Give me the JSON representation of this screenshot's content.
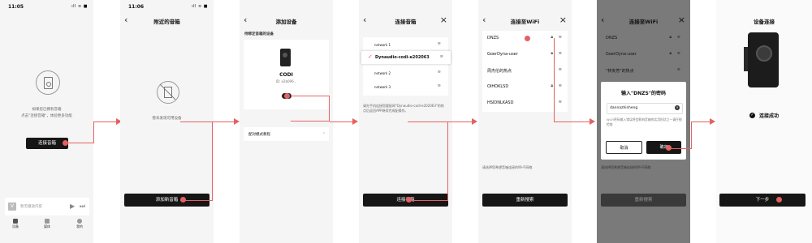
{
  "screen1": {
    "time": "11:05",
    "status_icons": "ıll ≋ ■",
    "empty_text_1": "如果您已拥有音箱",
    "empty_text_2": "点击\"连接音箱\"，体验更多功能",
    "connect_button": "连接音箱",
    "player_placeholder": "暂无播放内容",
    "nav": [
      "设备",
      "媒体",
      "我的"
    ]
  },
  "screen2": {
    "time": "11:06",
    "status_icons": "ıll ≋ ■",
    "title": "附近的音箱",
    "empty_text": "暂未发现可用设备",
    "add_button": "添加新音箱"
  },
  "screen3": {
    "title": "添加设备",
    "section": "待绑定音箱的设备",
    "device_name": "CODI",
    "device_id": "ID: e2b096...",
    "pair_mode": "配对模式教程"
  },
  "screen4": {
    "title": "连接音箱",
    "networks": [
      "network 1",
      "Dynaudio-codi-e202063",
      "network 2",
      "network 3"
    ],
    "selected": "Dynaudio-codi-e202063",
    "hint": "请先手机连接您要配网\"Dynaudio-codi-e202063\"的热点后返回APP继续完成配操作。",
    "connect_button": "连接音箱"
  },
  "screen5": {
    "title": "连接至WiFi",
    "networks": [
      "DNZS",
      "GoerDyna-user",
      "周杰伦的热点",
      "OIHOKLSD",
      "HSIDNLKASD"
    ],
    "hint": "请选择您希望音箱连接的Wi-Fi网络",
    "rescan_button": "重新搜索"
  },
  "screen6": {
    "title": "连接至WiFi",
    "networks": [
      "DNZS",
      "GoerDyna-user",
      "\"林夹芳\"的热点"
    ],
    "dialog_title": "输入\"DNZS\"的密码",
    "password_value": "dannazhisheng",
    "dialog_hint": "Wi-Fi密码输入错误将会影响音箱的实用形状之一请仔细检查",
    "cancel_button": "取消",
    "confirm_button": "确定",
    "hint": "请选择您希望音箱连接的Wi-Fi网络",
    "rescan_button": "重新搜索"
  },
  "screen7": {
    "title": "设备连接",
    "success_text": "连接成功",
    "next_button": "下一步"
  },
  "colors": {
    "accent": "#e56161",
    "dark": "#161616",
    "overlay": "#7a7a7a"
  }
}
